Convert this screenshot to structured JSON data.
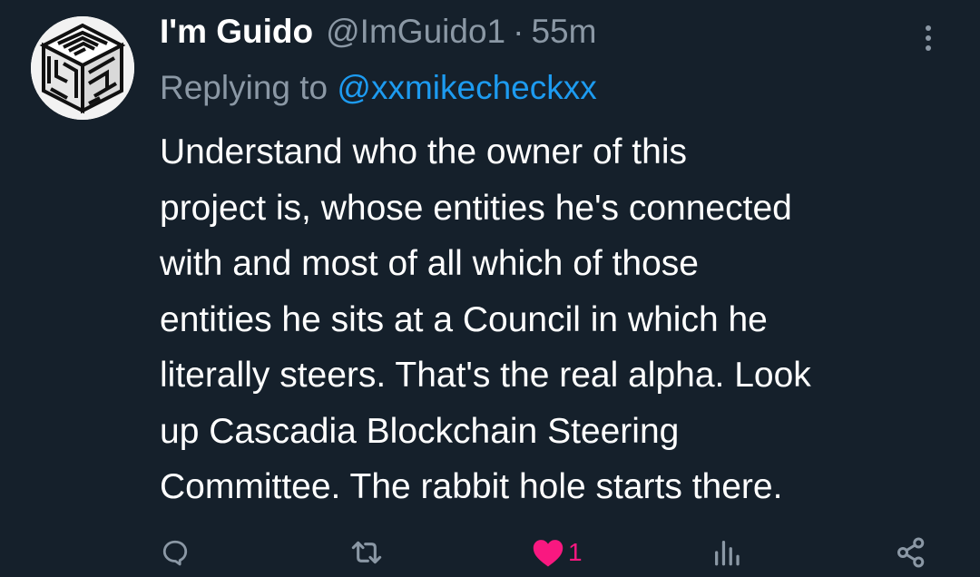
{
  "tweet": {
    "display_name": "I'm Guido",
    "handle": "@ImGuido1",
    "separator": "·",
    "time_ago": "55m",
    "replying_prefix": "Replying to ",
    "replying_handle": "@xxmikecheckxx",
    "text": "Understand who the owner of this\nproject is, whose entities he's connected\nwith and most of all which of those\nentities he sits at a Council in which he\nliterally steers. That's the real alpha. Look\nup Cascadia Blockchain Steering\nCommittee. The rabbit hole starts there."
  },
  "actions": {
    "reply_icon": "reply-icon",
    "retweet_icon": "retweet-icon",
    "like_icon": "heart-filled-icon",
    "like_count": "1",
    "views_icon": "views-icon",
    "share_icon": "share-icon"
  },
  "colors": {
    "background": "#15202b",
    "primary_text": "#ffffff",
    "secondary_text": "#8b98a5",
    "link": "#1d9bf0",
    "like": "#f91880"
  }
}
